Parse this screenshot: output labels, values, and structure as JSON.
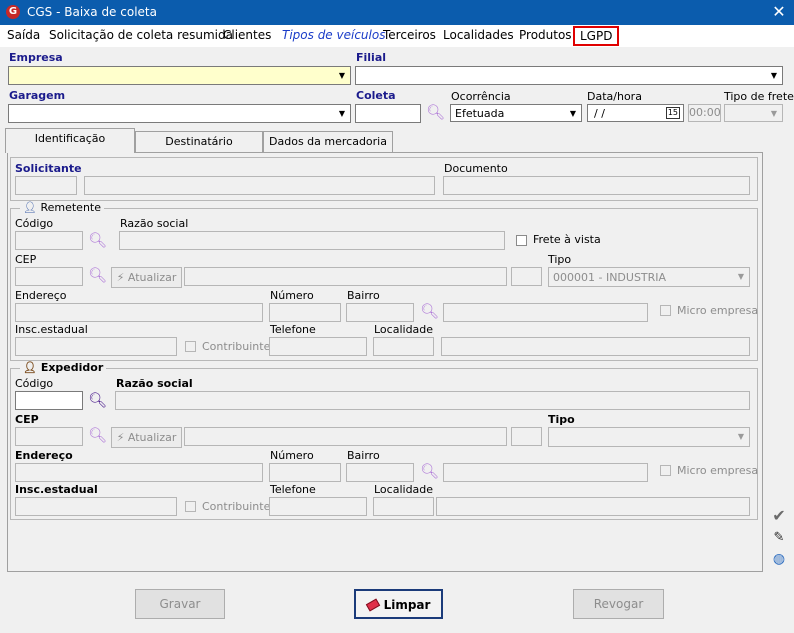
{
  "window": {
    "title": "CGS - Baixa de coleta",
    "icon_letter": "G",
    "close": "✕"
  },
  "menu": [
    "Saída",
    "Solicitação de coleta resumida",
    "Clientes",
    "Tipos de veículos",
    "Terceiros",
    "Localidades",
    "Produtos",
    "LGPD"
  ],
  "header": {
    "empresa_label": "Empresa",
    "filial_label": "Filial",
    "garagem_label": "Garagem",
    "coleta_label": "Coleta",
    "ocorrencia_label": "Ocorrência",
    "ocorrencia_value": "Efetuada",
    "datahora_label": "Data/hora",
    "date_value": " /  /",
    "calendar_icon": "15",
    "time_value": "00:00",
    "tipo_frete_label": "Tipo de frete"
  },
  "tabs": [
    "Identificação",
    "Destinatário",
    "Dados da mercadoria"
  ],
  "solicitante": {
    "label": "Solicitante",
    "documento_label": "Documento"
  },
  "remetente": {
    "title": "Remetente",
    "codigo_label": "Código",
    "razao_label": "Razão social",
    "frete_vista_label": "Frete à vista",
    "cep_label": "CEP",
    "atualizar_label": "Atualizar",
    "tipo_label": "Tipo",
    "tipo_value": "000001 - INDUSTRIA",
    "endereco_label": "Endereço",
    "numero_label": "Número",
    "bairro_label": "Bairro",
    "micro_label": "Micro empresa",
    "insc_label": "Insc.estadual",
    "contribuinte_label": "Contribuinte",
    "telefone_label": "Telefone",
    "localidade_label": "Localidade"
  },
  "expedidor": {
    "title": "Expedidor",
    "codigo_label": "Código",
    "razao_label": "Razão social",
    "cep_label": "CEP",
    "atualizar_label": "Atualizar",
    "tipo_label": "Tipo",
    "endereco_label": "Endereço",
    "numero_label": "Número",
    "bairro_label": "Bairro",
    "micro_label": "Micro empresa",
    "insc_label": "Insc.estadual",
    "contribuinte_label": "Contribuinte",
    "telefone_label": "Telefone",
    "localidade_label": "Localidade"
  },
  "icons": {
    "search": "search-icon",
    "lightning": "lightning-icon",
    "person": "person-icon",
    "check": "check-icon",
    "eraser": "eraser-icon"
  },
  "buttons": {
    "gravar": "Gravar",
    "limpar": "Limpar",
    "revogar": "Revogar"
  },
  "colors": {
    "titlebar": "#0b5cad",
    "lgpd_border": "#e00000",
    "required_label": "#1b1b8c",
    "empresa_field": "#ffffcc"
  }
}
